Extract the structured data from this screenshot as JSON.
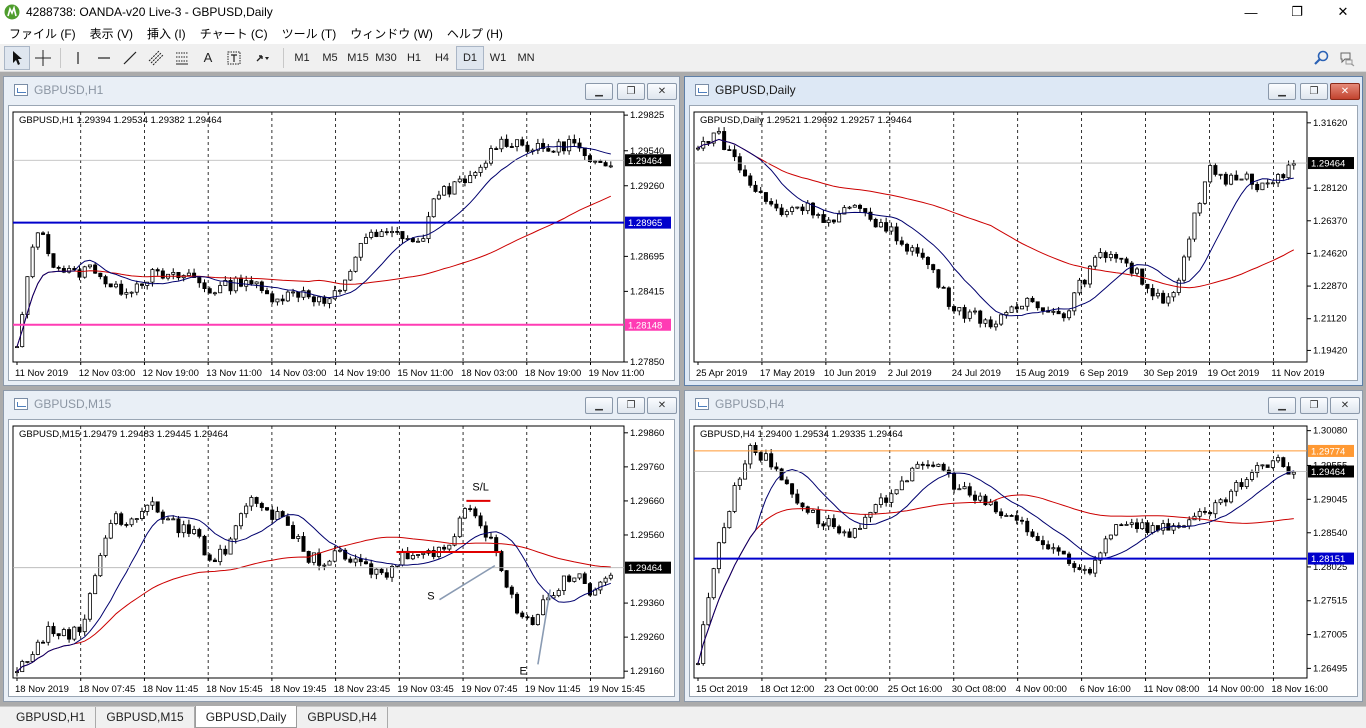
{
  "window": {
    "title": "4288738: OANDA-v20 Live-3 - GBPUSD,Daily",
    "minimize": "—",
    "maximize": "❐",
    "close": "✕"
  },
  "menu": [
    "ファイル (F)",
    "表示 (V)",
    "挿入 (I)",
    "チャート (C)",
    "ツール (T)",
    "ウィンドウ (W)",
    "ヘルプ (H)"
  ],
  "toolbar": {
    "text_tool": "A",
    "timeframes": [
      "M1",
      "M5",
      "M15",
      "M30",
      "H1",
      "H4",
      "D1",
      "W1",
      "MN"
    ],
    "selected_timeframe": "D1"
  },
  "colors": {
    "blue_line": "#0000cc",
    "pink_line": "#ff3cb4",
    "orange_line": "#ff9933",
    "red_ma": "#cc0000",
    "navy_ma": "#00006e",
    "active_border": "#5e7fa8"
  },
  "charts": [
    {
      "window_title": "GBPUSD,H1",
      "active": false,
      "info": "GBPUSD,H1  1.29394 1.29534 1.29382 1.29464",
      "ylim": [
        1.2785,
        1.2985
      ],
      "price_labels": [
        "1.29825",
        "1.29540",
        "1.29260",
        "1.28695",
        "1.28415",
        "1.27850"
      ],
      "price_values": [
        1.29825,
        1.2954,
        1.2926,
        1.28695,
        1.28415,
        1.2785
      ],
      "time_labels": [
        "11 Nov 2019",
        "12 Nov 03:00",
        "12 Nov 19:00",
        "13 Nov 11:00",
        "14 Nov 03:00",
        "14 Nov 19:00",
        "15 Nov 11:00",
        "18 Nov 03:00",
        "18 Nov 19:00",
        "19 Nov 11:00"
      ],
      "current_price": 1.29464,
      "current_label": "1.29464",
      "hlines": [
        {
          "value": 1.28965,
          "label": "1.28965",
          "color": "#0000cc"
        },
        {
          "value": 1.28148,
          "label": "1.28148",
          "color": "#ff3cb4"
        }
      ],
      "path": [
        1.2795,
        1.2895,
        1.2862,
        1.2855,
        1.2862,
        1.2842,
        1.2845,
        1.2855,
        1.2852,
        1.2855,
        1.2842,
        1.2846,
        1.2852,
        1.2838,
        1.2838,
        1.2842,
        1.2832,
        1.2842,
        1.2884,
        1.2886,
        1.2888,
        1.2878,
        1.2922,
        1.2926,
        1.2934,
        1.296,
        1.2962,
        1.2955,
        1.2955,
        1.2962,
        1.294,
        1.2946
      ]
    },
    {
      "window_title": "GBPUSD,Daily",
      "active": true,
      "info": "GBPUSD,Daily  1.29521 1.29692 1.29257 1.29464",
      "ylim": [
        1.188,
        1.322
      ],
      "price_labels": [
        "1.31620",
        "1.28120",
        "1.26370",
        "1.24620",
        "1.22870",
        "1.21120",
        "1.19420"
      ],
      "price_values": [
        1.3162,
        1.2812,
        1.2637,
        1.2462,
        1.2287,
        1.2112,
        1.1942
      ],
      "time_labels": [
        "25 Apr 2019",
        "17 May 2019",
        "10 Jun 2019",
        "2 Jul 2019",
        "24 Jul 2019",
        "15 Aug 2019",
        "6 Sep 2019",
        "30 Sep 2019",
        "19 Oct 2019",
        "11 Nov 2019"
      ],
      "current_price": 1.29464,
      "current_label": "1.29464",
      "hlines": [],
      "path": [
        1.302,
        1.312,
        1.3,
        1.285,
        1.275,
        1.268,
        1.272,
        1.27,
        1.262,
        1.27,
        1.268,
        1.262,
        1.255,
        1.248,
        1.24,
        1.222,
        1.215,
        1.212,
        1.208,
        1.215,
        1.222,
        1.218,
        1.212,
        1.228,
        1.242,
        1.248,
        1.24,
        1.23,
        1.222,
        1.228,
        1.265,
        1.292,
        1.285,
        1.29,
        1.282,
        1.285,
        1.294
      ]
    },
    {
      "window_title": "GBPUSD,M15",
      "active": false,
      "info": "GBPUSD,M15  1.29479 1.29483 1.29445 1.29464",
      "ylim": [
        1.2914,
        1.2988
      ],
      "price_labels": [
        "1.29860",
        "1.29760",
        "1.29660",
        "1.29560",
        "1.29360",
        "1.29260",
        "1.29160"
      ],
      "price_values": [
        1.2986,
        1.2976,
        1.2966,
        1.2956,
        1.2936,
        1.2926,
        1.2916
      ],
      "time_labels": [
        "18 Nov 2019",
        "18 Nov 07:45",
        "18 Nov 11:45",
        "18 Nov 15:45",
        "18 Nov 19:45",
        "18 Nov 23:45",
        "19 Nov 03:45",
        "19 Nov 07:45",
        "19 Nov 11:45",
        "19 Nov 15:45"
      ],
      "current_price": 1.29464,
      "current_label": "1.29464",
      "hlines": [],
      "annotations": [
        {
          "text": "S/L",
          "note_value": 1.2969
        },
        {
          "text": "S",
          "note_value": 1.2937
        },
        {
          "text": "E",
          "note_value": 1.2915
        }
      ],
      "path": [
        1.2916,
        1.2922,
        1.2928,
        1.2927,
        1.2928,
        1.2948,
        1.2962,
        1.2958,
        1.2966,
        1.2962,
        1.2958,
        1.2958,
        1.2948,
        1.2952,
        1.2964,
        1.2966,
        1.2962,
        1.2958,
        1.295,
        1.2948,
        1.295,
        1.2948,
        1.2946,
        1.2944,
        1.295,
        1.2952,
        1.295,
        1.2954,
        1.2966,
        1.2958,
        1.295,
        1.2935,
        1.293,
        1.2938,
        1.2942,
        1.2944,
        1.2938,
        1.2946
      ]
    },
    {
      "window_title": "GBPUSD,H4",
      "active": false,
      "info": "GBPUSD,H4  1.29400 1.29534 1.29335 1.29464",
      "ylim": [
        1.2635,
        1.3015
      ],
      "price_labels": [
        "1.30080",
        "1.29555",
        "1.29045",
        "1.28540",
        "1.28025",
        "1.27515",
        "1.27005",
        "1.26495"
      ],
      "price_values": [
        1.3008,
        1.29555,
        1.29045,
        1.2854,
        1.28025,
        1.27515,
        1.27005,
        1.26495
      ],
      "time_labels": [
        "15 Oct 2019",
        "18 Oct 12:00",
        "23 Oct 00:00",
        "25 Oct 16:00",
        "30 Oct 08:00",
        "4 Nov 00:00",
        "6 Nov 16:00",
        "11 Nov 08:00",
        "14 Nov 00:00",
        "18 Nov 16:00"
      ],
      "current_price": 1.29464,
      "current_label": "1.29464",
      "hlines": [
        {
          "value": 1.29774,
          "label": "1.29774",
          "color": "#ff9933"
        },
        {
          "value": 1.28151,
          "label": "1.28151",
          "color": "#0000cc"
        }
      ],
      "path": [
        1.266,
        1.282,
        1.2905,
        1.2985,
        1.2965,
        1.2935,
        1.29,
        1.2875,
        1.2865,
        1.2845,
        1.2875,
        1.2905,
        1.2935,
        1.295,
        1.296,
        1.293,
        1.291,
        1.2895,
        1.288,
        1.287,
        1.284,
        1.2825,
        1.28,
        1.2795,
        1.285,
        1.2875,
        1.2865,
        1.286,
        1.2865,
        1.2875,
        1.288,
        1.2905,
        1.293,
        1.295,
        1.296,
        1.2946
      ]
    }
  ],
  "tabs": [
    "GBPUSD,H1",
    "GBPUSD,M15",
    "GBPUSD,Daily",
    "GBPUSD,H4"
  ],
  "active_tab": "GBPUSD,Daily"
}
